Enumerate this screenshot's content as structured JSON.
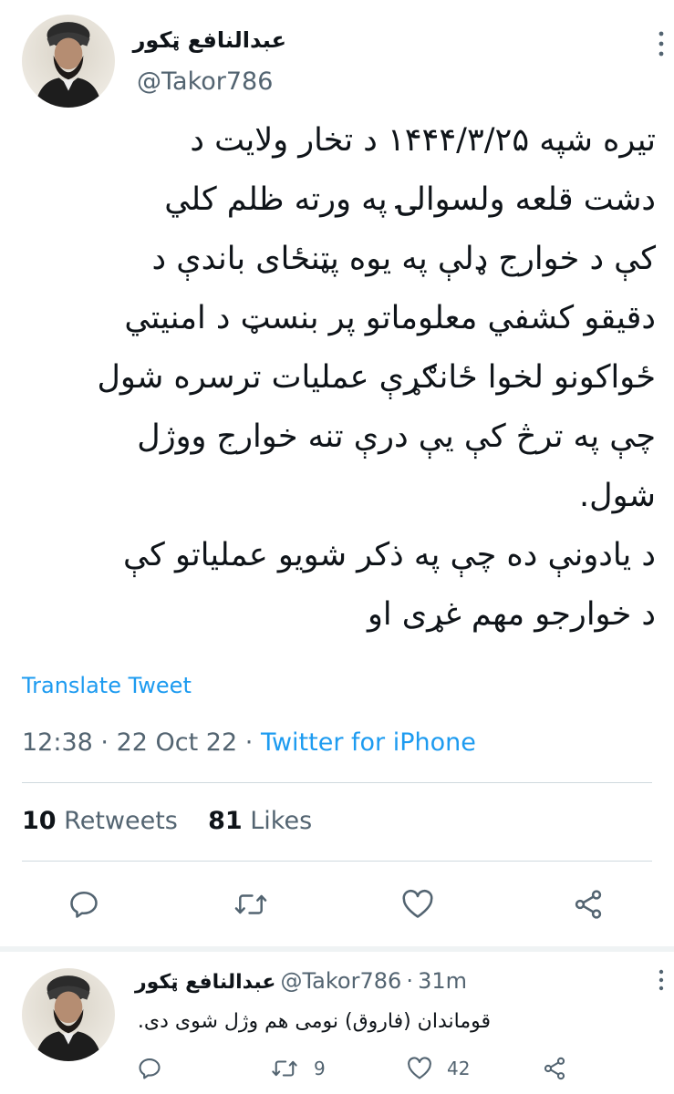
{
  "tweet": {
    "author_name": "عبدالنافع ټکور",
    "author_handle": "@Takor786",
    "body": "تیره شپه ۱۴۴۴/۳/۲۵ د تخار ولایت د\nدشت قلعه ولسوالۍ په ورته ظلم کلي\nکې د خوارج ډلې په یوه پټنځای باندې د\nدقیقو کشفي معلوماتو پر بنسټ د امنیتي\nځواکونو لخوا ځانګړې عملیات ترسره شول\nچې په ترڅ کې یې درې تنه خوارج ووژل\nشول.\nد یادونې ده چې په ذکر شویو عملیاتو کې\nد خوارجو مهم غړی او",
    "translate_label": "Translate Tweet",
    "time": "12:38",
    "date": "22 Oct 22",
    "sep": "·",
    "source": "Twitter for iPhone",
    "retweets_count": "10",
    "retweets_label": "Retweets",
    "likes_count": "81",
    "likes_label": "Likes"
  },
  "reply": {
    "author_name": "عبدالنافع ټکور",
    "author_handle": "@Takor786",
    "sep": "·",
    "age": "31m",
    "text": "قوماندان (فاروق) نومی هم وژل شوی دی.",
    "retweet_count": "9",
    "like_count": "42"
  },
  "icons": {
    "more": "more-vertical-icon",
    "reply": "reply-icon",
    "retweet": "retweet-icon",
    "like": "heart-icon",
    "share": "share-icon"
  },
  "colors": {
    "link": "#1d9bf0",
    "muted": "#536471",
    "divider": "#cfd9de"
  }
}
